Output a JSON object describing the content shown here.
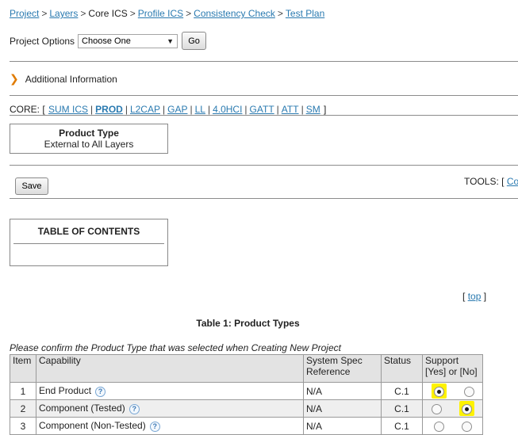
{
  "breadcrumb": {
    "items": [
      {
        "label": "Project",
        "link": true
      },
      {
        "label": "Layers",
        "link": true
      },
      {
        "label": "Core ICS",
        "link": false
      },
      {
        "label": "Profile ICS",
        "link": true
      },
      {
        "label": "Consistency Check",
        "link": true
      },
      {
        "label": "Test Plan",
        "link": true
      }
    ],
    "separator": ">"
  },
  "project_options": {
    "label": "Project Options",
    "select_value": "Choose One",
    "go_label": "Go"
  },
  "additional_info": {
    "label": "Additional Information"
  },
  "core_nav": {
    "prefix": "CORE: [",
    "suffix": "]",
    "items": [
      "SUM ICS",
      "PROD",
      "L2CAP",
      "GAP",
      "LL",
      "4.0HCI",
      "GATT",
      "ATT",
      "SM"
    ],
    "active": "PROD"
  },
  "product_type_box": {
    "title": "Product Type",
    "subtitle": "External to All Layers"
  },
  "save_label": "Save",
  "tools": {
    "prefix": "TOOLS: [",
    "link": "Co"
  },
  "toc": {
    "title": "TABLE OF CONTENTS"
  },
  "top_link": {
    "open": "[",
    "label": "top",
    "close": "]"
  },
  "table": {
    "title": "Table 1: Product Types",
    "instruction": "Please confirm the Product Type that was selected when Creating New Project",
    "headers": {
      "item": "Item",
      "capability": "Capability",
      "reference_1": "System Spec",
      "reference_2": "Reference",
      "status": "Status",
      "support_1": "Support",
      "support_2": "[Yes] or [No]"
    },
    "rows": [
      {
        "item": "1",
        "capability": "End Product",
        "reference": "N/A",
        "status": "C.1",
        "support": "yes"
      },
      {
        "item": "2",
        "capability": "Component (Tested)",
        "reference": "N/A",
        "status": "C.1",
        "support": "no"
      },
      {
        "item": "3",
        "capability": "Component (Non-Tested)",
        "reference": "N/A",
        "status": "C.1",
        "support": ""
      }
    ]
  },
  "colors": {
    "link": "#2a7ab0",
    "highlight": "#fff200",
    "chevron": "#e07b00",
    "header_bg": "#e3e3e3"
  }
}
